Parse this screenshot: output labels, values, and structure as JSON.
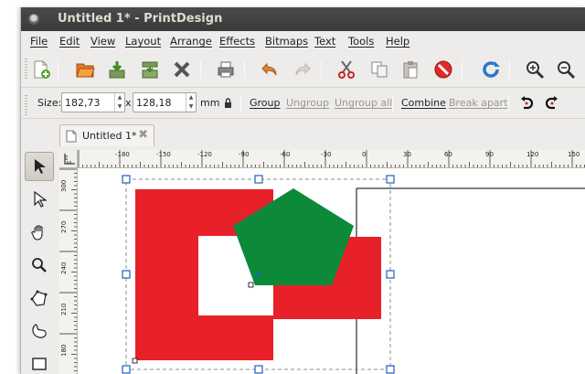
{
  "window": {
    "title": "Untitled 1* - PrintDesign"
  },
  "menu": [
    "File",
    "Edit",
    "View",
    "Layout",
    "Arrange",
    "Effects",
    "Bitmaps",
    "Text",
    "Tools",
    "Help"
  ],
  "toolbar": {
    "icons": [
      "new-document-icon",
      "open-folder-icon",
      "save-icon",
      "save-as-icon",
      "close-icon",
      "print-icon",
      "undo-icon",
      "redo-icon",
      "cut-icon",
      "copy-icon",
      "paste-icon",
      "delete-icon",
      "refresh-icon",
      "zoom-in-icon",
      "zoom-out-icon"
    ]
  },
  "props": {
    "size_label": "Size:",
    "width": "182,73",
    "times": "x",
    "height": "128,18",
    "unit": "mm",
    "group": "Group",
    "ungroup": "Ungroup",
    "ungroup_all": "Ungroup all",
    "combine": "Combine",
    "break_apart": "Break apart",
    "enabled": {
      "group": true,
      "ungroup": false,
      "ungroup_all": false,
      "combine": true,
      "break_apart": false
    }
  },
  "tab": {
    "label": "Untitled 1*"
  },
  "tools": [
    "selector-icon",
    "node-edit-icon",
    "pan-hand-icon",
    "zoom-icon",
    "polygon-icon",
    "curve-icon",
    "rectangle-icon"
  ],
  "ruler": {
    "h_labels": [
      "-180",
      "-150",
      "-120",
      "-90",
      "-60",
      "-30",
      "0",
      "30",
      "60",
      "90",
      "120",
      "150"
    ],
    "v_labels": [
      "300",
      "270",
      "240",
      "210",
      "180"
    ]
  },
  "colors": {
    "red": "#e8202a",
    "green": "#0c8a3a",
    "accent": "#1f5fbf"
  }
}
